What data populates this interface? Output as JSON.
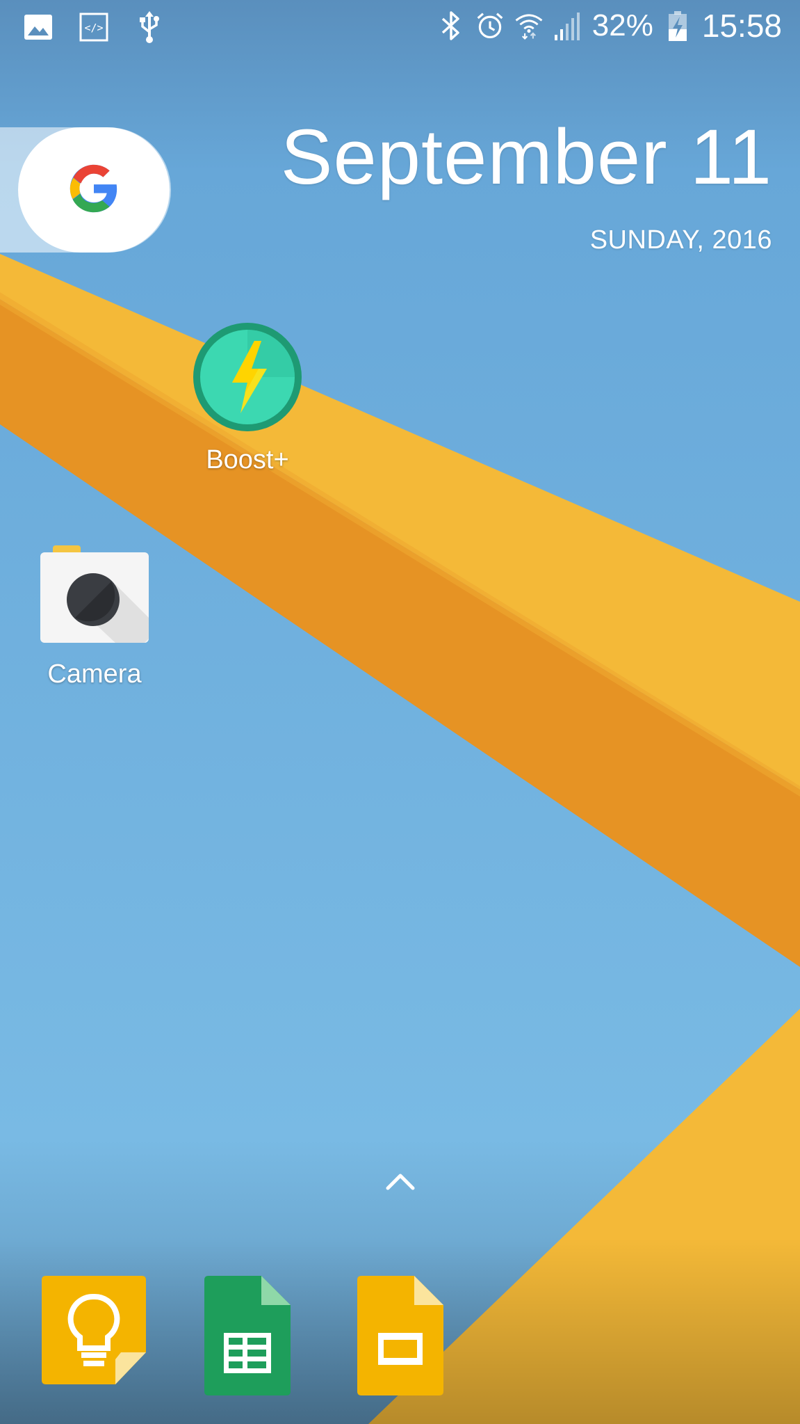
{
  "status_bar": {
    "left_icons": [
      "image-icon",
      "developer-code-icon",
      "usb-icon"
    ],
    "right_icons": [
      "bluetooth-icon",
      "alarm-icon",
      "wifi-icon",
      "cell-signal-icon",
      "battery-icon"
    ],
    "battery_percent": "32%",
    "time": "15:58"
  },
  "search_widget": {
    "icon": "google-g-icon"
  },
  "date_widget": {
    "date": "September 11",
    "day_year": "SUNDAY, 2016"
  },
  "home_apps": [
    {
      "label": "Boost+",
      "icon": "boost-lightning-icon"
    },
    {
      "label": "Camera",
      "icon": "camera-icon"
    }
  ],
  "app_drawer": {
    "icon": "chevron-up-icon"
  },
  "dock": [
    {
      "name": "Keep",
      "icon": "keep-lightbulb-icon"
    },
    {
      "name": "Sheets",
      "icon": "sheets-grid-icon"
    },
    {
      "name": "Slides",
      "icon": "slides-icon"
    }
  ],
  "colors": {
    "sky": "#6fb0dd",
    "band_light": "#f4b938",
    "band_dark": "#e69324",
    "boost": "#2dbf9b",
    "sheets": "#1e9e5b",
    "keep": "#f4b400",
    "slides": "#f4b400"
  }
}
